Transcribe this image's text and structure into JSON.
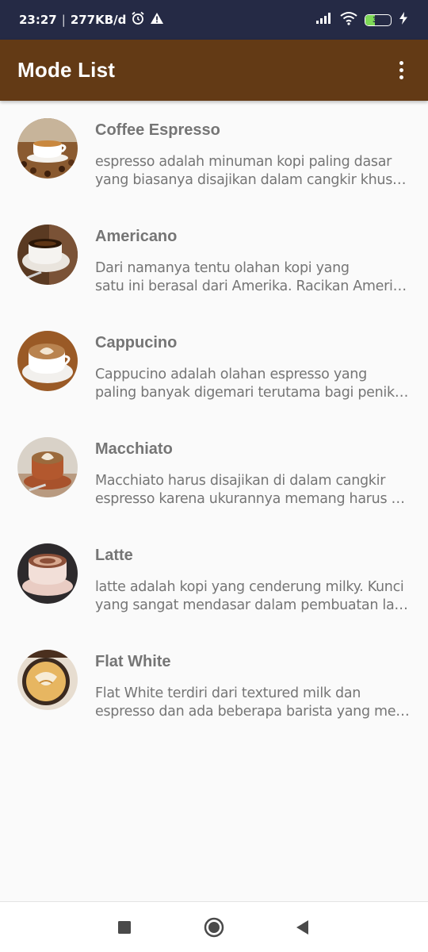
{
  "status_bar": {
    "time": "23:27",
    "separator": "|",
    "speed": "277KB/d",
    "battery": "39"
  },
  "app_bar": {
    "title": "Mode List"
  },
  "items": [
    {
      "title": "Coffee Espresso",
      "line1": "espresso adalah minuman kopi paling dasar",
      "line2": "yang biasanya disajikan dalam cangkir khusus kecil"
    },
    {
      "title": "Americano",
      "line1": "Dari namanya tentu olahan kopi yang",
      "line2": "satu ini berasal dari Amerika. Racikan Americano"
    },
    {
      "title": "Cappucino",
      "line1": "Cappucino adalah olahan espresso yang",
      "line2": "paling banyak digemari terutama bagi penikmat kopi"
    },
    {
      "title": "Macchiato",
      "line1": "Macchiato harus disajikan di dalam cangkir",
      "line2": "espresso karena ukurannya memang harus kecil"
    },
    {
      "title": "Latte",
      "line1": "latte adalah kopi yang cenderung milky. Kunci",
      "line2": "yang sangat mendasar dalam pembuatan latte adalah"
    },
    {
      "title": "Flat White",
      "line1": "Flat White terdiri dari textured milk dan",
      "line2": "espresso dan ada beberapa barista yang menambahkan"
    }
  ],
  "colors": {
    "status_bar": "#252a45",
    "app_bar": "#633a15",
    "text_secondary": "#757575",
    "background": "#fafafa"
  }
}
